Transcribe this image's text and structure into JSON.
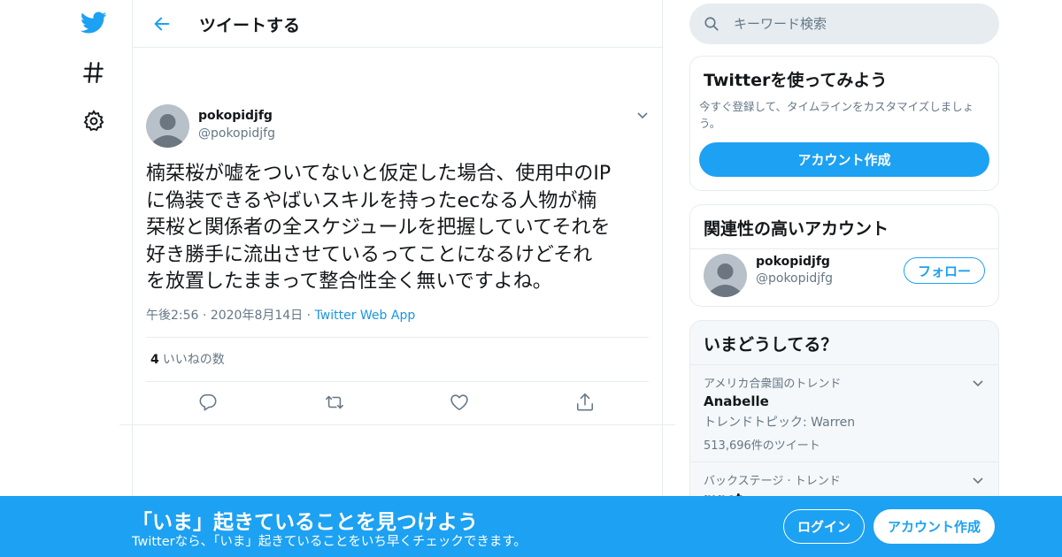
{
  "nav": {
    "icons": [
      "twitter-logo-icon",
      "hashtag-icon",
      "gear-icon"
    ],
    "accent_color": "#1da1f2"
  },
  "header": {
    "title": "ツイートする"
  },
  "tweet": {
    "author_name": "pokopidjfg",
    "author_handle": "@pokopidjfg",
    "text_lines": [
      "楠栞桜が嘘をついてないと仮定した場合、使用中のIP",
      "に偽装できるやばいスキルを持ったecなる人物が楠",
      "栞桜と関係者の全スケジュールを把握していてそれを",
      "好き勝手に流出させているってことになるけどそれ",
      "を放置したままって整合性全く無いですよね。"
    ],
    "time": "午後2:56",
    "date": "2020年8月14日",
    "source": "Twitter Web App",
    "likes_count": "4",
    "likes_label": "いいねの数"
  },
  "search": {
    "placeholder": "キーワード検索"
  },
  "signup_card": {
    "title": "Twitterを使ってみよう",
    "description": "今すぐ登録して、タイムラインをカスタマイズしましょう。",
    "button": "アカウント作成"
  },
  "related_card": {
    "title": "関連性の高いアカウント",
    "account_name": "pokopidjfg",
    "account_handle": "@pokopidjfg",
    "follow_button": "フォロー"
  },
  "trends_card": {
    "title": "いまどうしてる？",
    "items": [
      {
        "context": "アメリカ合衆国のトレンド",
        "name": "Anabelle",
        "subtitle": "トレンドトピック: Warren",
        "count": "513,696件のツイート"
      },
      {
        "context": "バックステージ · トレンド",
        "name": "mnet",
        "subtitle": "",
        "count": ""
      }
    ]
  },
  "banner": {
    "title": "「いま」起きていることを見つけよう",
    "subtitle": "Twitterなら、「いま」起きていることをいち早くチェックできます。",
    "login": "ログイン",
    "signup": "アカウント作成"
  }
}
